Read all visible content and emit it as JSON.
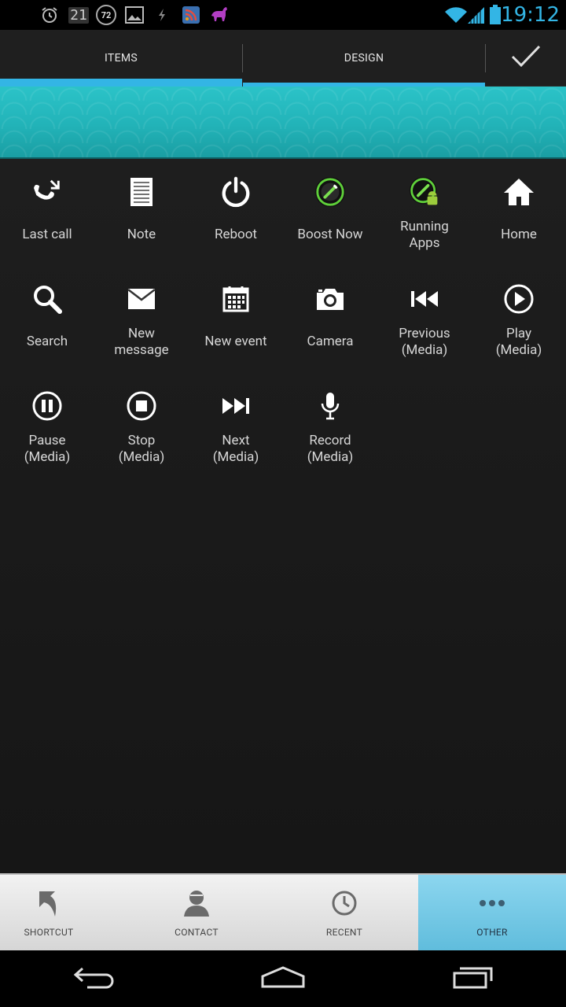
{
  "status_bar": {
    "date": "21",
    "temperature": "72",
    "time": "19:12",
    "icons": [
      "alarm-icon",
      "calendar-date-icon",
      "temperature-icon",
      "gallery-icon",
      "usb-icon",
      "rss-icon",
      "notification-animal-icon",
      "wifi-icon",
      "signal-icon",
      "battery-icon"
    ]
  },
  "top_tabs": {
    "items_label": "ITEMS",
    "design_label": "DESIGN",
    "confirm_icon": "check-icon"
  },
  "colors": {
    "accent": "#33b5e5",
    "banner": "#22b3b8",
    "background": "#1a1a1a",
    "active_tab": "#7ccbe7"
  },
  "grid_items": [
    {
      "label": "Last call",
      "icon": "last-call-icon"
    },
    {
      "label": "Note",
      "icon": "note-icon"
    },
    {
      "label": "Reboot",
      "icon": "power-icon"
    },
    {
      "label": "Boost Now",
      "icon": "boost-icon"
    },
    {
      "label": "Running\nApps",
      "icon": "running-apps-icon"
    },
    {
      "label": "Home",
      "icon": "home-icon"
    },
    {
      "label": "Search",
      "icon": "search-icon"
    },
    {
      "label": "New\nmessage",
      "icon": "envelope-icon"
    },
    {
      "label": "New event",
      "icon": "calendar-icon"
    },
    {
      "label": "Camera",
      "icon": "camera-icon"
    },
    {
      "label": "Previous\n(Media)",
      "icon": "previous-icon"
    },
    {
      "label": "Play\n(Media)",
      "icon": "play-icon"
    },
    {
      "label": "Pause\n(Media)",
      "icon": "pause-icon"
    },
    {
      "label": "Stop\n(Media)",
      "icon": "stop-icon"
    },
    {
      "label": "Next\n(Media)",
      "icon": "next-icon"
    },
    {
      "label": "Record\n(Media)",
      "icon": "microphone-icon"
    }
  ],
  "bottom_tabs": [
    {
      "label": "SHORTCUT",
      "icon": "shortcut-arrow-icon"
    },
    {
      "label": "CONTACT",
      "icon": "contact-icon"
    },
    {
      "label": "RECENT",
      "icon": "clock-icon"
    },
    {
      "label": "OTHER",
      "icon": "more-dots-icon",
      "active": true
    }
  ],
  "nav_bar": [
    "back-icon",
    "home-outline-icon",
    "recent-apps-icon"
  ]
}
